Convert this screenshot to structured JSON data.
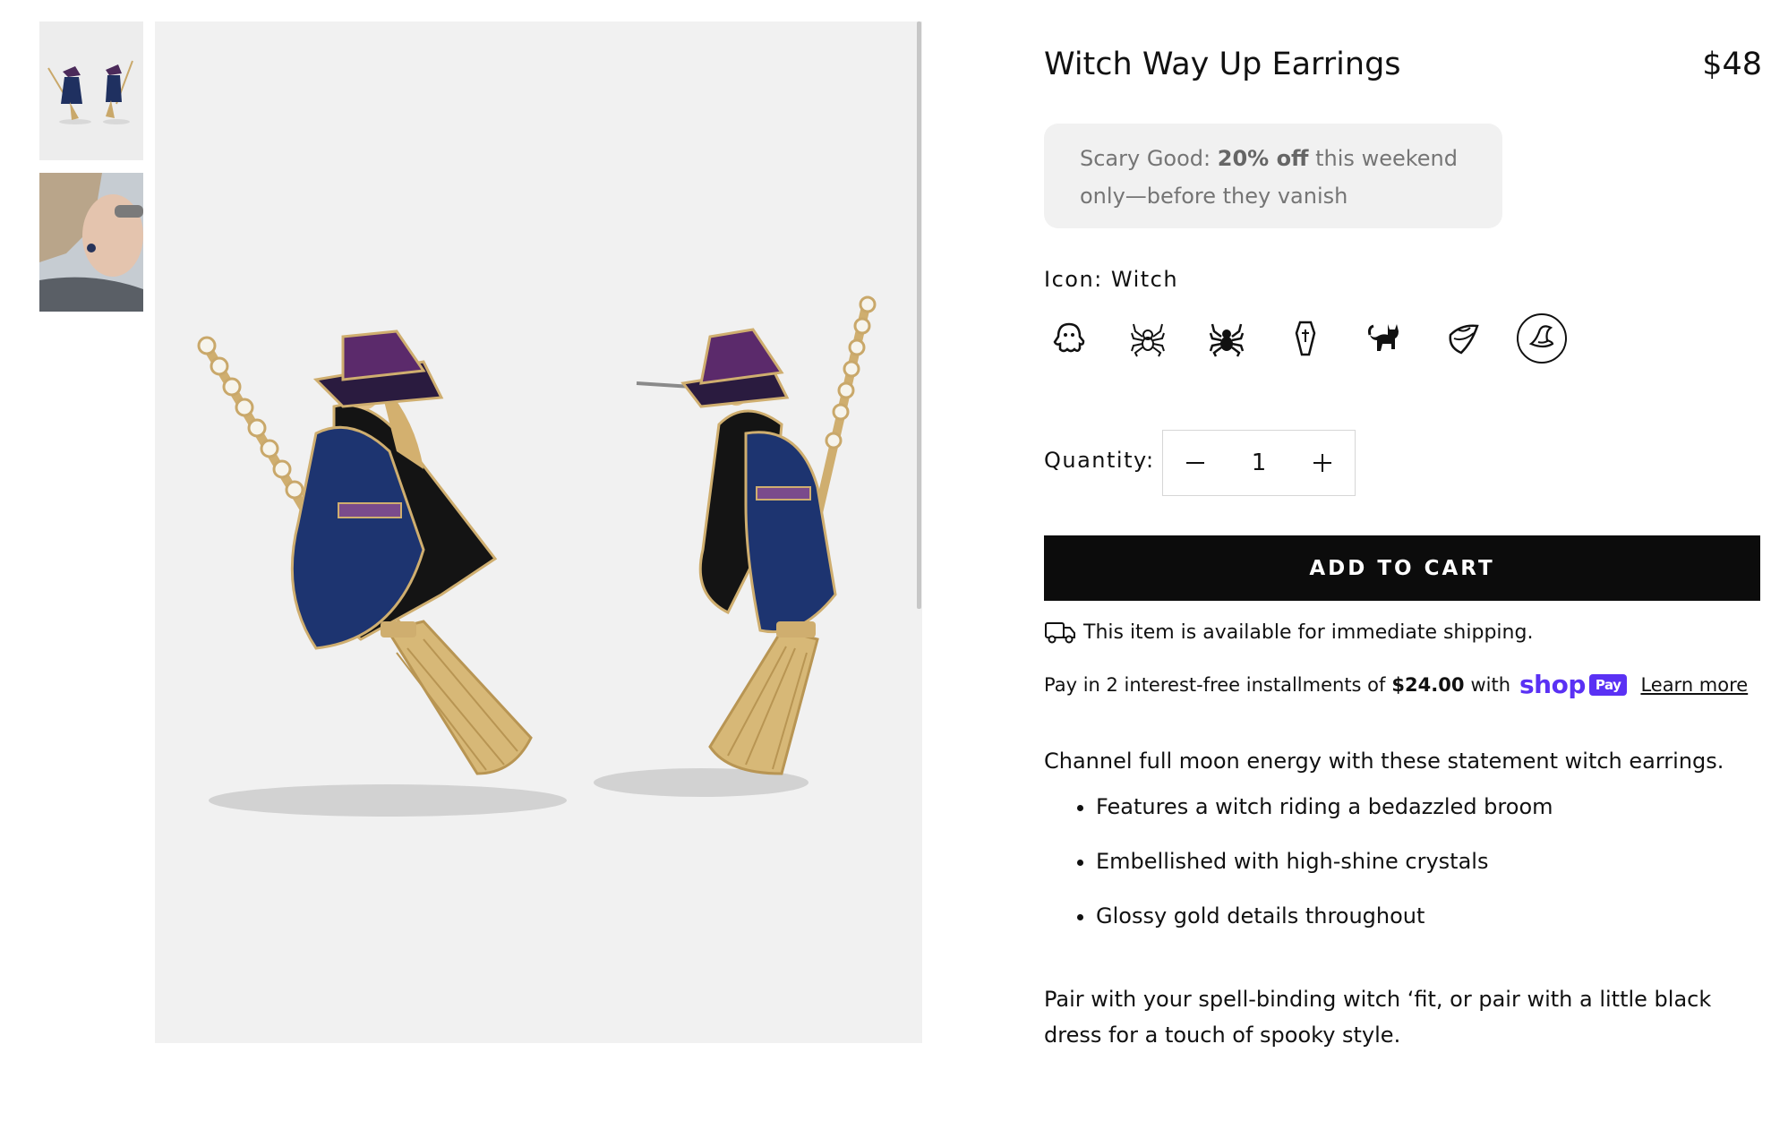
{
  "product": {
    "title": "Witch Way Up Earrings",
    "price": "$48"
  },
  "promo": {
    "lead": "Scary Good:",
    "highlight": "20% off",
    "rest": "this weekend only—before they vanish"
  },
  "variant": {
    "label": "Icon: Witch",
    "options": [
      {
        "icon": "ghost-icon"
      },
      {
        "icon": "spider-outline-icon"
      },
      {
        "icon": "spider-icon"
      },
      {
        "icon": "coffin-icon"
      },
      {
        "icon": "black-cat-icon"
      },
      {
        "icon": "candy-corn-icon"
      },
      {
        "icon": "witch-hat-icon",
        "selected": true
      }
    ]
  },
  "quantity": {
    "label": "Quantity:",
    "value": "1"
  },
  "cart": {
    "button_label": "ADD TO CART"
  },
  "shipping": {
    "text": "This item is available for immediate shipping."
  },
  "installments": {
    "prefix": "Pay in 2 interest-free installments of",
    "amount": "$24.00",
    "with": "with",
    "brand": "shop",
    "badge": "Pay",
    "learn_more": "Learn more"
  },
  "description": {
    "intro": "Channel full moon energy with these statement witch earrings.",
    "features": [
      "Features a witch riding a bedazzled broom",
      "Embellished with high-shine crystals",
      "Glossy gold details throughout"
    ],
    "outro": "Pair with your spell-binding witch ‘fit, or pair with a little black dress for a touch of spooky style."
  },
  "colors": {
    "brand_purple": "#5a31f4",
    "button_bg": "#0c0c0c",
    "promo_bg": "#f1f1f1"
  }
}
